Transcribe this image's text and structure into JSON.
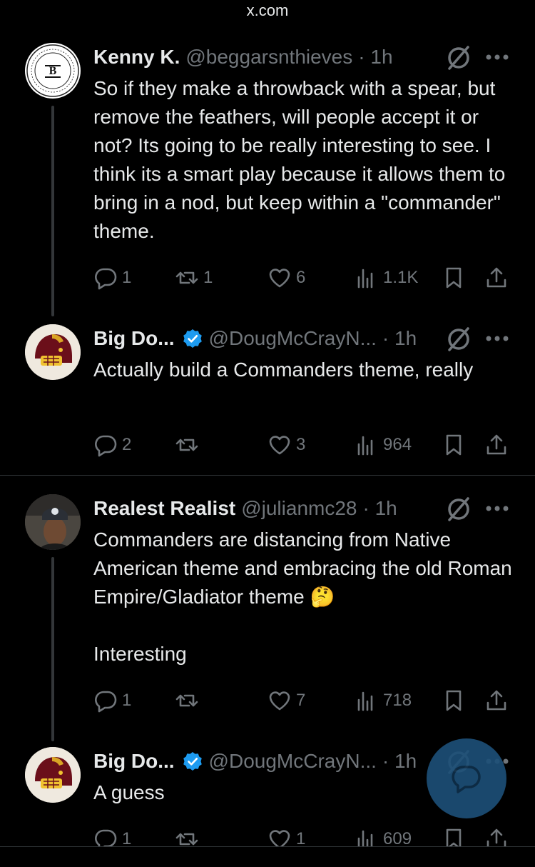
{
  "browser": {
    "url": "x.com"
  },
  "tweets": [
    {
      "name": "Kenny K.",
      "handle": "@beggarsnthieves",
      "time": "· 1h",
      "text": "So if they make a throwback with a spear, but remove the feathers, will people accept it or not? Its going to be really interesting to see. I think its a smart play because it allows them to bring in a nod, but keep within a \"commander\" theme.",
      "replies": "1",
      "reposts": "1",
      "likes": "6",
      "views": "1.1K",
      "avatar": "beggars-thieves-logo"
    },
    {
      "name": "Big Do...",
      "handle": "@DougMcCrayN...",
      "time": "· 1h",
      "text": "Actually build a Commanders theme, really",
      "replies": "2",
      "reposts": "",
      "likes": "3",
      "views": "964",
      "verified": true,
      "avatar": "commanders-helmet"
    },
    {
      "name": "Realest Realist",
      "handle": "@julianmc28",
      "time": "· 1h",
      "text": "Commanders are distancing from Native American theme and embracing the old Roman Empire/Gladiator theme 🤔",
      "text2": "Interesting",
      "replies": "1",
      "reposts": "",
      "likes": "7",
      "views": "718",
      "avatar": "user-photo"
    },
    {
      "name": "Big Do...",
      "handle": "@DougMcCrayN...",
      "time": "· 1h",
      "text": "A guess",
      "replies": "1",
      "reposts": "",
      "likes": "1",
      "views": "609",
      "verified": true,
      "avatar": "commanders-helmet"
    }
  ],
  "colors": {
    "background": "#000000",
    "text": "#e7e9ea",
    "muted": "#71767b",
    "verified": "#1d9bf0",
    "fab": "#1d4f77"
  },
  "icons": [
    "reply-icon",
    "repost-icon",
    "like-icon",
    "views-icon",
    "bookmark-icon",
    "share-icon",
    "grok-icon",
    "more-icon",
    "verified-icon",
    "compose-reply-icon"
  ]
}
